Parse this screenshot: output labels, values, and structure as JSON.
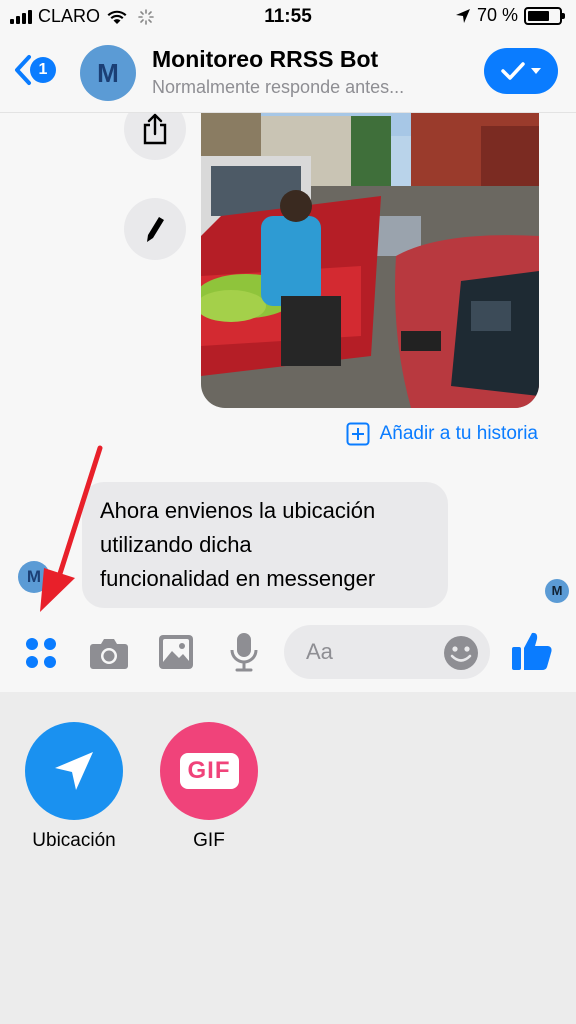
{
  "status_bar": {
    "carrier": "CLARO",
    "time": "11:55",
    "battery": "70 %",
    "battery_level": 0.7
  },
  "header": {
    "back_badge": "1",
    "avatar_letter": "M",
    "title": "Monitoreo RRSS Bot",
    "subtitle": "Normalmente responde antes..."
  },
  "chat": {
    "add_to_story": "Añadir a tu historia",
    "message_lines": [
      "Ahora envienos la ubicación",
      "utilizando dicha",
      "funcionalidad en messenger"
    ],
    "sender_avatar_letter": "M",
    "read_receipt_letter": "M"
  },
  "composer": {
    "placeholder": "Aa"
  },
  "drawer": {
    "items": [
      {
        "label": "Ubicación",
        "color": "#1a91f0",
        "icon": "location-arrow-icon"
      },
      {
        "label": "GIF",
        "color": "#f0437a",
        "icon": "gif-icon",
        "icon_text": "GIF"
      }
    ]
  },
  "colors": {
    "accent": "#0a7cff",
    "annotation_arrow": "#e8202a"
  }
}
